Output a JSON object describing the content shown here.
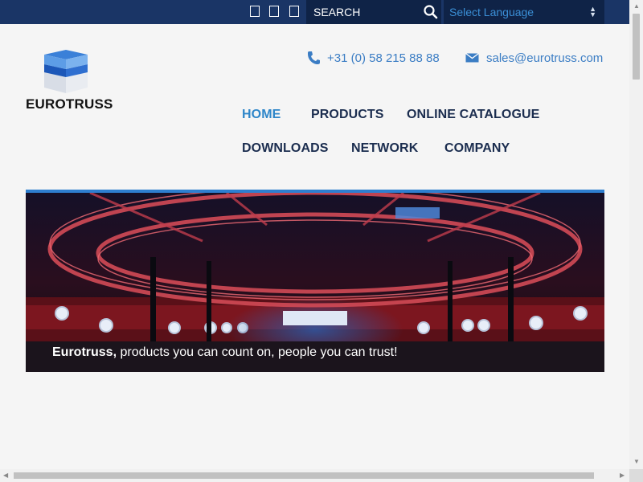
{
  "topbar": {
    "search_placeholder": "SEARCH",
    "language_select": "Select Language"
  },
  "logo": {
    "text": "EUROTRUSS"
  },
  "contact": {
    "phone": "+31 (0) 58 215 88 88",
    "email": "sales@eurotruss.com"
  },
  "nav": {
    "home": "HOME",
    "products": "PRODUCTS",
    "online_catalogue": "ONLINE CATALOGUE",
    "downloads": "DOWNLOADS",
    "network": "NETWORK",
    "company": "COMPANY"
  },
  "hero": {
    "caption_bold": "Eurotruss,",
    "caption_rest": " products you can count on, people you can trust!"
  },
  "colors": {
    "topbar": "#1a3566",
    "accent": "#2e86c9",
    "nav_text": "#1b2d4f"
  },
  "icons": [
    "social-icon",
    "search-icon",
    "select-arrows-icon",
    "phone-icon",
    "mail-icon"
  ]
}
